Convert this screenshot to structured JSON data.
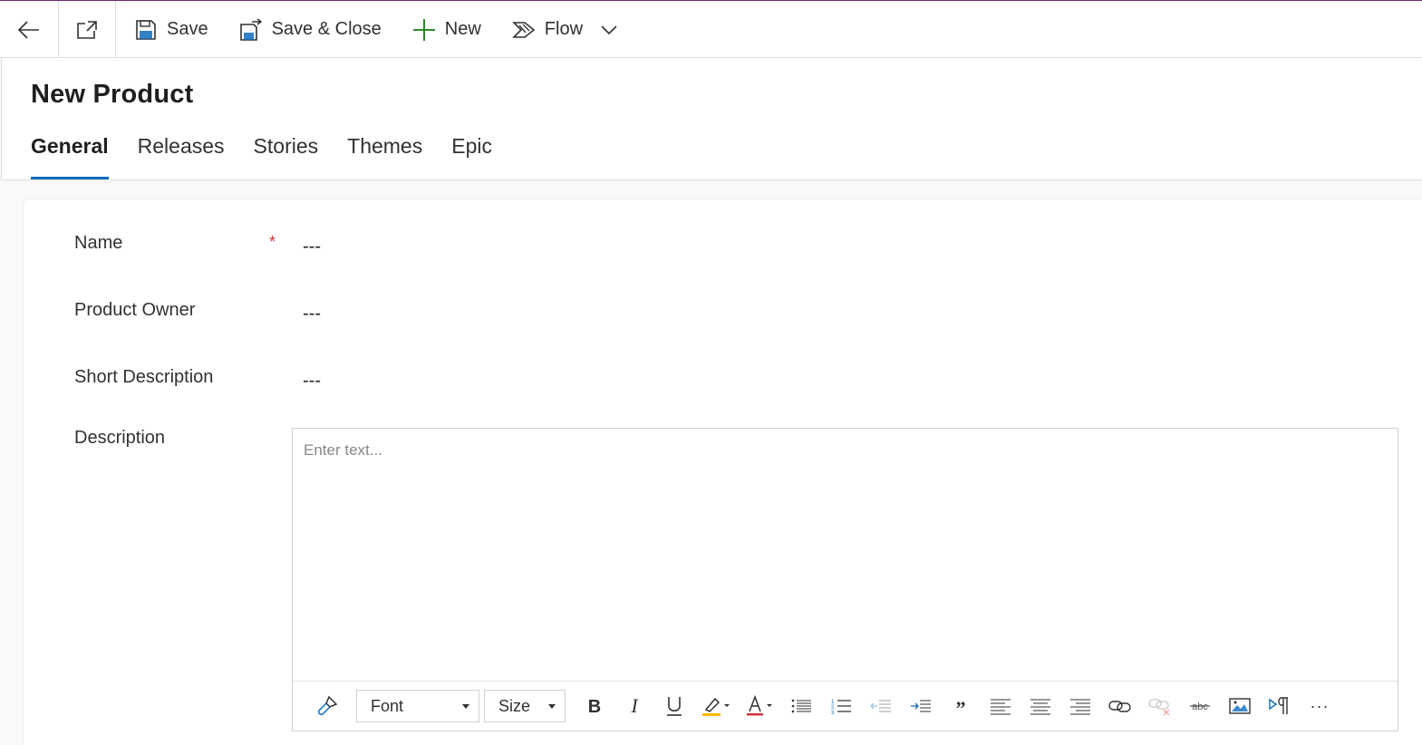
{
  "commandbar": {
    "save_label": "Save",
    "save_close_label": "Save & Close",
    "new_label": "New",
    "flow_label": "Flow"
  },
  "header": {
    "title": "New Product",
    "tabs": [
      {
        "label": "General",
        "active": true
      },
      {
        "label": "Releases",
        "active": false
      },
      {
        "label": "Stories",
        "active": false
      },
      {
        "label": "Themes",
        "active": false
      },
      {
        "label": "Epic",
        "active": false
      }
    ]
  },
  "form": {
    "fields": [
      {
        "label": "Name",
        "value": "---",
        "required": true
      },
      {
        "label": "Product Owner",
        "value": "---",
        "required": false
      },
      {
        "label": "Short Description",
        "value": "---",
        "required": false
      }
    ],
    "required_marker": "*",
    "description": {
      "label": "Description",
      "placeholder": "Enter text..."
    }
  },
  "editor_toolbar": {
    "font_label": "Font",
    "size_label": "Size",
    "more_label": "···",
    "buttons": [
      "format-painter",
      "bold",
      "italic",
      "underline",
      "highlight-color",
      "font-color",
      "bulleted-list",
      "numbered-list",
      "decrease-indent",
      "increase-indent",
      "blockquote",
      "align-left",
      "align-center",
      "align-right",
      "insert-link",
      "remove-link",
      "strikethrough",
      "insert-image",
      "text-direction"
    ]
  },
  "colors": {
    "accent": "#0f6cbd",
    "brand_top_border": "#742774",
    "required": "#d13438",
    "new_icon": "#107c10",
    "highlight_bar": "#ffb900",
    "font_color_bar": "#d13438"
  }
}
